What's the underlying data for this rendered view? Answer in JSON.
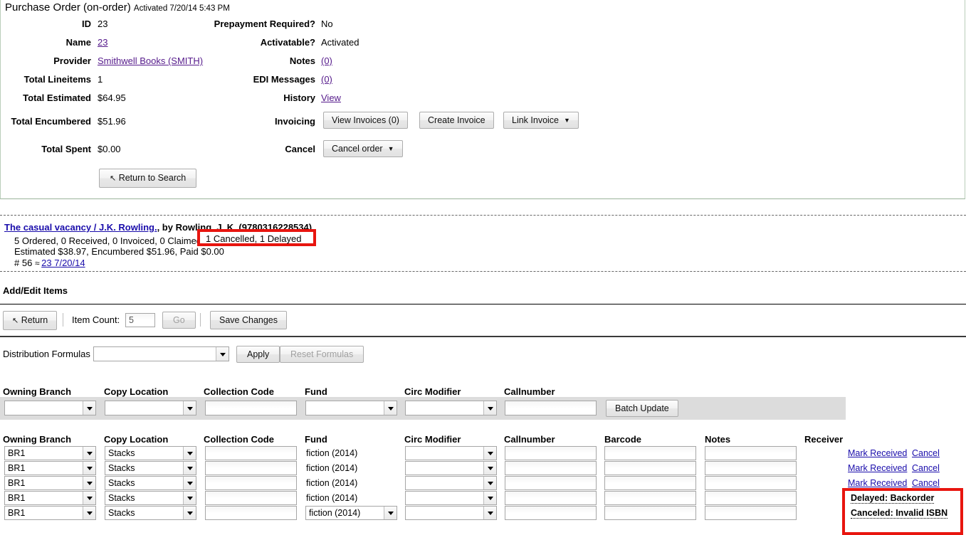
{
  "purchase_order": {
    "title": "Purchase Order (on-order)",
    "activated_text": "Activated 7/20/14 5:43 PM",
    "left_fields": [
      {
        "label": "ID",
        "value": "23",
        "type": "text"
      },
      {
        "label": "Name",
        "value": "23",
        "type": "link"
      },
      {
        "label": "Provider",
        "value": "Smithwell Books (SMITH)",
        "type": "link"
      },
      {
        "label": "Total Lineitems",
        "value": "1",
        "type": "text"
      },
      {
        "label": "Total Estimated",
        "value": "$64.95",
        "type": "text"
      },
      {
        "label": "Total Encumbered",
        "value": "$51.96",
        "type": "text"
      },
      {
        "label": "Total Spent",
        "value": "$0.00",
        "type": "text"
      }
    ],
    "right_fields": [
      {
        "label": "Prepayment Required?",
        "value": "No",
        "type": "text"
      },
      {
        "label": "Activatable?",
        "value": "Activated",
        "type": "text"
      },
      {
        "label": "Notes",
        "value": "(0)",
        "type": "link"
      },
      {
        "label": "EDI Messages",
        "value": "(0)",
        "type": "link"
      },
      {
        "label": "History",
        "value": "View",
        "type": "link"
      },
      {
        "label": "Invoicing",
        "value": "",
        "type": "buttons"
      },
      {
        "label": "Cancel",
        "value": "",
        "type": "buttons"
      }
    ],
    "invoicing_buttons": [
      {
        "label": "View Invoices (0)",
        "dropdown": false
      },
      {
        "label": "Create Invoice",
        "dropdown": false
      },
      {
        "label": "Link Invoice",
        "dropdown": true
      }
    ],
    "cancel_button": {
      "label": "Cancel order",
      "dropdown": true
    },
    "return_to_search_button": {
      "label": "Return to Search",
      "icon": "back-arrow-icon",
      "glyph": "↖"
    }
  },
  "lineitem": {
    "title_link": "The casual vacancy / J.K. Rowling.",
    "title_rest": ", by Rowling, J. K. (9780316228534)",
    "counts_line": "5 Ordered, 0 Received, 0 Invoiced, 0 Claimed",
    "counts_highlight": "1 Cancelled, 1 Delayed",
    "money_line": "Estimated $38.97, Encumbered $51.96, Paid $0.00",
    "number_prefix": "# 56",
    "chain_glyph": "≈",
    "number_link": "23 7/20/14"
  },
  "add_edit_items": {
    "section_title": "Add/Edit Items",
    "return_button": {
      "label": "Return",
      "glyph": "↖"
    },
    "item_count_label": "Item Count:",
    "item_count_value": "5",
    "go_button": "Go",
    "save_changes_button": "Save Changes",
    "distribution_formulas_label": "Distribution Formulas",
    "distribution_formulas_value": "",
    "apply_button": "Apply",
    "reset_formulas_button": "Reset Formulas"
  },
  "batch_update": {
    "headers": [
      "Owning Branch",
      "Copy Location",
      "Collection Code",
      "Fund",
      "Circ Modifier",
      "Callnumber"
    ],
    "values": [
      "",
      "",
      "",
      "",
      "",
      ""
    ],
    "button_label": "Batch Update"
  },
  "items_table": {
    "headers": [
      "Owning Branch",
      "Copy Location",
      "Collection Code",
      "Fund",
      "Circ Modifier",
      "Callnumber",
      "Barcode",
      "Notes",
      "Receiver"
    ],
    "rows": [
      {
        "owning_branch": "BR1",
        "copy_location": "Stacks",
        "collection_code": "",
        "fund": "fiction (2014)",
        "fund_is_select": false,
        "circ_modifier": "",
        "callnumber": "",
        "barcode": "",
        "notes": "",
        "action_primary": "Mark Received",
        "action_secondary": "Cancel",
        "state": ""
      },
      {
        "owning_branch": "BR1",
        "copy_location": "Stacks",
        "collection_code": "",
        "fund": "fiction (2014)",
        "fund_is_select": false,
        "circ_modifier": "",
        "callnumber": "",
        "barcode": "",
        "notes": "",
        "action_primary": "Mark Received",
        "action_secondary": "Cancel",
        "state": ""
      },
      {
        "owning_branch": "BR1",
        "copy_location": "Stacks",
        "collection_code": "",
        "fund": "fiction (2014)",
        "fund_is_select": false,
        "circ_modifier": "",
        "callnumber": "",
        "barcode": "",
        "notes": "",
        "action_primary": "Mark Received",
        "action_secondary": "Cancel",
        "state": ""
      },
      {
        "owning_branch": "BR1",
        "copy_location": "Stacks",
        "collection_code": "",
        "fund": "fiction (2014)",
        "fund_is_select": false,
        "circ_modifier": "",
        "callnumber": "",
        "barcode": "",
        "notes": "",
        "action_primary": "",
        "action_secondary": "",
        "state": "Delayed: Backorder"
      },
      {
        "owning_branch": "BR1",
        "copy_location": "Stacks",
        "collection_code": "",
        "fund": "fiction (2014)",
        "fund_is_select": true,
        "circ_modifier": "",
        "callnumber": "",
        "barcode": "",
        "notes": "",
        "action_primary": "",
        "action_secondary": "",
        "state": "Canceled: Invalid ISBN"
      }
    ]
  },
  "annotations": {
    "highlight_color": "#e8150f",
    "box1_text": "1 Cancelled, 1 Delayed",
    "box2_texts": [
      "Delayed: Backorder",
      "Canceled: Invalid ISBN"
    ]
  }
}
